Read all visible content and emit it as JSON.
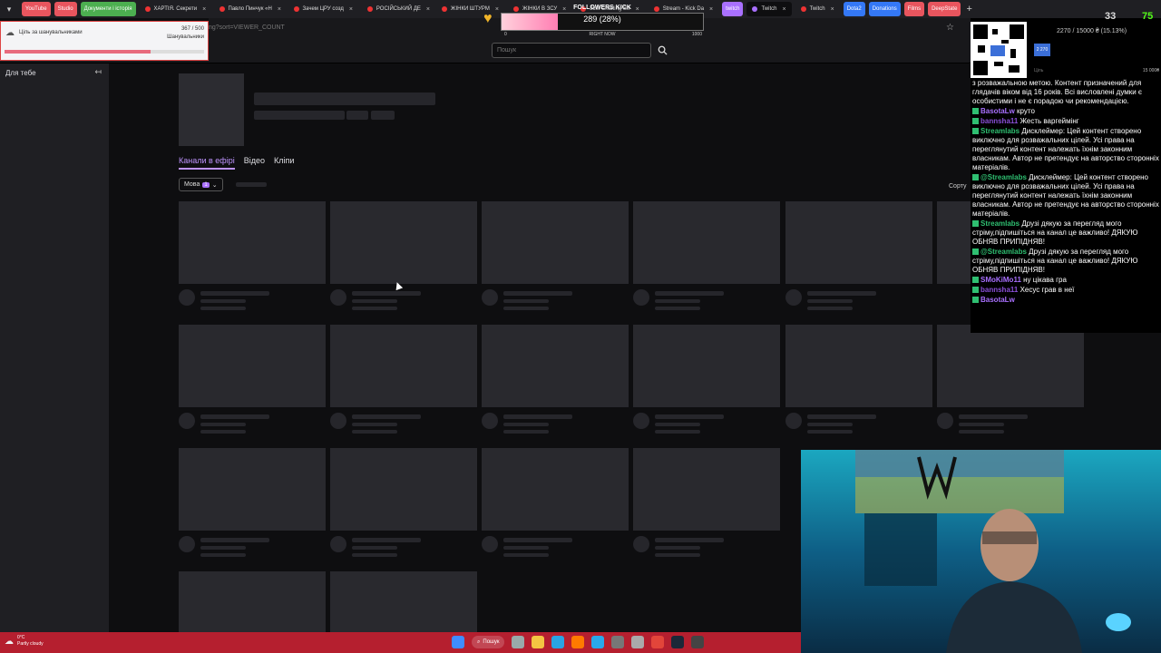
{
  "browser": {
    "tabs": [
      {
        "label": "YouTube",
        "kind": "chip"
      },
      {
        "label": "Studio",
        "kind": "chip"
      },
      {
        "label": "Документи і історія",
        "kind": "chip-green"
      },
      {
        "label": "ХАРТІЯ. Секрети",
        "kind": "tab"
      },
      {
        "label": "Павло Пинчук «Н",
        "kind": "tab"
      },
      {
        "label": "Зачем ЦРУ созд",
        "kind": "tab"
      },
      {
        "label": "РОСІЙСЬКИЙ ДЕ",
        "kind": "tab"
      },
      {
        "label": "ЖІНКИ ШТУРМ",
        "kind": "tab"
      },
      {
        "label": "ЖІНКИ В ЗСУ",
        "kind": "tab"
      },
      {
        "label": "Just Chatting Str",
        "kind": "tab"
      },
      {
        "label": "Stream - Kick Da",
        "kind": "tab"
      },
      {
        "label": "twitch",
        "kind": "chip-purple"
      },
      {
        "label": "Twitch",
        "kind": "active"
      },
      {
        "label": "Twitch",
        "kind": "tab"
      },
      {
        "label": "Dota2",
        "kind": "chip-blue"
      },
      {
        "label": "Donations",
        "kind": "chip-blue"
      },
      {
        "label": "Films",
        "kind": "chip"
      },
      {
        "label": "DeepState",
        "kind": "chip"
      }
    ],
    "url_fragment": "ng?sort=VIEWER_COUNT"
  },
  "header": {
    "search_placeholder": "Пошук"
  },
  "sidebar": {
    "title": "Для тебе"
  },
  "main": {
    "tabs": [
      {
        "label": "Канали в ефірі",
        "active": true
      },
      {
        "label": "Відео",
        "active": false
      },
      {
        "label": "Кліпи",
        "active": false
      }
    ],
    "language_button": "Мова",
    "language_count": "1",
    "sort_label": "Сорту"
  },
  "overlays": {
    "goal": {
      "title": "Ціль за шанувальниками",
      "count": "367 / 500",
      "sub": "Шанувальники",
      "progress": 0.73
    },
    "followers": {
      "title": "FOLLOWERS KICK",
      "value": "289 (28%)",
      "min": "0",
      "center": "RIGHT NOW",
      "max": "1000",
      "progress": 0.28
    },
    "subs_goal": {
      "text": "2270 / 15000 ₴ (15.13%)",
      "chip": "2 270",
      "left": "Ціль",
      "right": "15 000₴"
    },
    "counters": {
      "left": "33",
      "right": "75"
    }
  },
  "chat": [
    {
      "user": "",
      "text": "з розважальною метою. Контент призначений для глядачів віком від 16 років. Всі висловлені думки є особистими і не є порадою чи рекомендацією.",
      "color": "#ffffff"
    },
    {
      "user": "BasotaLw",
      "text": "круто",
      "color": "#a970ff"
    },
    {
      "user": "bannsha11",
      "text": "Жесть варгеймінг",
      "color": "#8a4fd8"
    },
    {
      "user": "Streamlabs",
      "text": "Дисклеймер: Цей контент створено виключно для розважальних цілей. Усі права на переглянутий контент належать їхнім законним власникам. Автор не претендує на авторство сторонніх матеріалів.",
      "color": "#2fbf71"
    },
    {
      "user": "@Streamlabs",
      "text": "Дисклеймер: Цей контент створено виключно для розважальних цілей. Усі права на переглянутий контент належать їхнім законним власникам. Автор не претендує на авторство сторонніх матеріалів.",
      "color": "#2fbf71"
    },
    {
      "user": "Streamlabs",
      "text": "Друзі дякую за перегляд мого стріму,підпишіться на канал це важливо! ДЯКУЮ ОБНЯВ ПРИПІДНЯВ!",
      "color": "#2fbf71"
    },
    {
      "user": "@Streamlabs",
      "text": "Друзі дякую за перегляд мого стріму,підпишіться на канал це важливо! ДЯКУЮ ОБНЯВ ПРИПІДНЯВ!",
      "color": "#2fbf71"
    },
    {
      "user": "SMoKiMo11",
      "text": "ну цікава гра",
      "color": "#a970ff"
    },
    {
      "user": "bannsha11",
      "text": "Хесус грав в неї",
      "color": "#8a4fd8"
    },
    {
      "user": "BasotaLw",
      "text": "",
      "color": "#a970ff"
    }
  ],
  "taskbar": {
    "temp": "0°C",
    "weather": "Partly cloudy",
    "search": "Пошук"
  }
}
